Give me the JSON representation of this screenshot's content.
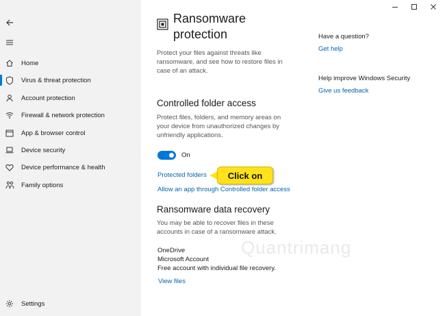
{
  "nav": {
    "back_icon": "back-arrow-icon",
    "menu_icon": "hamburger-menu-icon",
    "items": [
      {
        "label": "Home",
        "icon": "home-icon"
      },
      {
        "label": "Virus & threat protection",
        "icon": "shield-icon",
        "active": true
      },
      {
        "label": "Account protection",
        "icon": "person-icon"
      },
      {
        "label": "Firewall & network protection",
        "icon": "wifi-icon"
      },
      {
        "label": "App & browser control",
        "icon": "app-window-icon"
      },
      {
        "label": "Device security",
        "icon": "laptop-icon"
      },
      {
        "label": "Device performance & health",
        "icon": "heart-icon"
      },
      {
        "label": "Family options",
        "icon": "family-icon"
      }
    ],
    "settings": {
      "label": "Settings",
      "icon": "gear-icon"
    }
  },
  "window": {
    "minimize_icon": "minimize-icon",
    "maximize_icon": "maximize-icon",
    "close_icon": "close-icon"
  },
  "main": {
    "title": "Ransomware protection",
    "title_icon": "ransomware-icon",
    "description": "Protect your files against threats like ransomware, and see how to restore files in case of an attack.",
    "cfa": {
      "heading": "Controlled folder access",
      "description": "Protect files, folders, and memory areas on your device from unauthorized changes by unfriendly applications.",
      "toggle_state": "On",
      "toggle_on": true,
      "protected_folders_link": "Protected folders",
      "allow_app_link": "Allow an app through Controlled folder access"
    },
    "recovery": {
      "heading": "Ransomware data recovery",
      "description": "You may be able to recover files in these accounts in case of a ransomware attack.",
      "provider": "OneDrive",
      "account": "Microsoft Account",
      "plan": "Free account with individual file recovery.",
      "view_files_link": "View files"
    }
  },
  "aside": {
    "question_heading": "Have a question?",
    "get_help_link": "Get help",
    "improve_heading": "Help improve Windows Security",
    "feedback_link": "Give us feedback"
  },
  "annotation": {
    "callout_text": "Click on",
    "callout_color": "#ffe21a"
  },
  "watermark": {
    "text": "Quantrimang"
  },
  "colors": {
    "accent": "#0078d7",
    "link": "#0063b1",
    "sidebar_bg": "#f2f2f2"
  }
}
